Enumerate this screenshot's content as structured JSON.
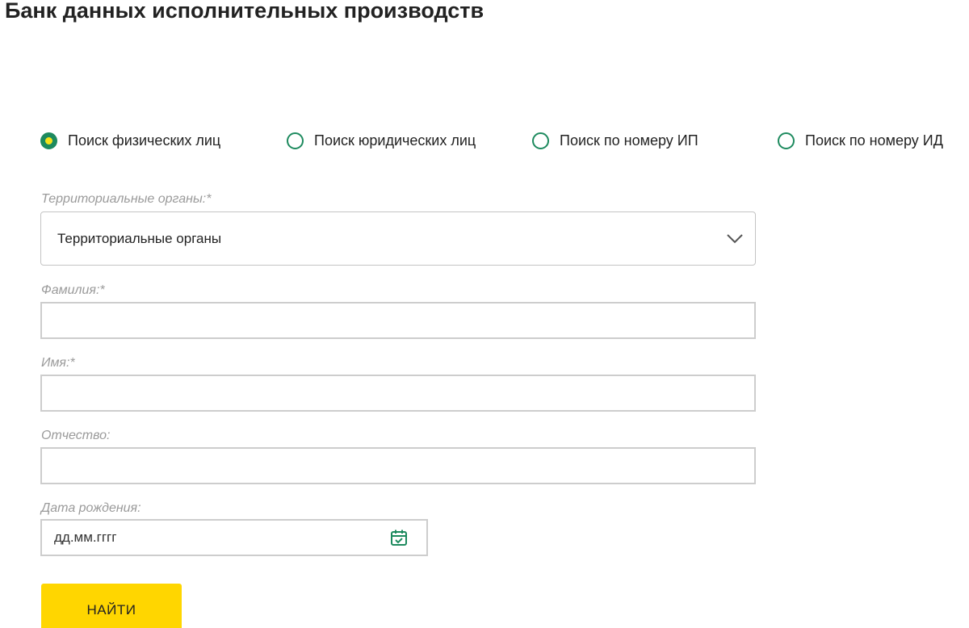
{
  "page": {
    "title": "Банк данных исполнительных производств"
  },
  "search_modes": [
    {
      "label": "Поиск физических лиц",
      "selected": true
    },
    {
      "label": "Поиск юридических лиц",
      "selected": false
    },
    {
      "label": "Поиск по номеру ИП",
      "selected": false
    },
    {
      "label": "Поиск по номеру ИД",
      "selected": false
    }
  ],
  "form": {
    "territorial": {
      "label": "Территориальные органы:*",
      "value": "Территориальные органы"
    },
    "last_name": {
      "label": "Фамилия:*",
      "value": ""
    },
    "first_name": {
      "label": "Имя:*",
      "value": ""
    },
    "patronymic": {
      "label": "Отчество:",
      "value": ""
    },
    "birth_date": {
      "label": "Дата рождения:",
      "placeholder": "дд.мм.гггг"
    },
    "submit_label": "НАЙТИ"
  },
  "colors": {
    "accent_green": "#1d8a5e",
    "radio_dot_yellow": "#f4e21a",
    "button_yellow": "#ffd600"
  },
  "icons": {
    "dropdown": "chevron-down-icon",
    "calendar": "calendar-check-icon"
  }
}
